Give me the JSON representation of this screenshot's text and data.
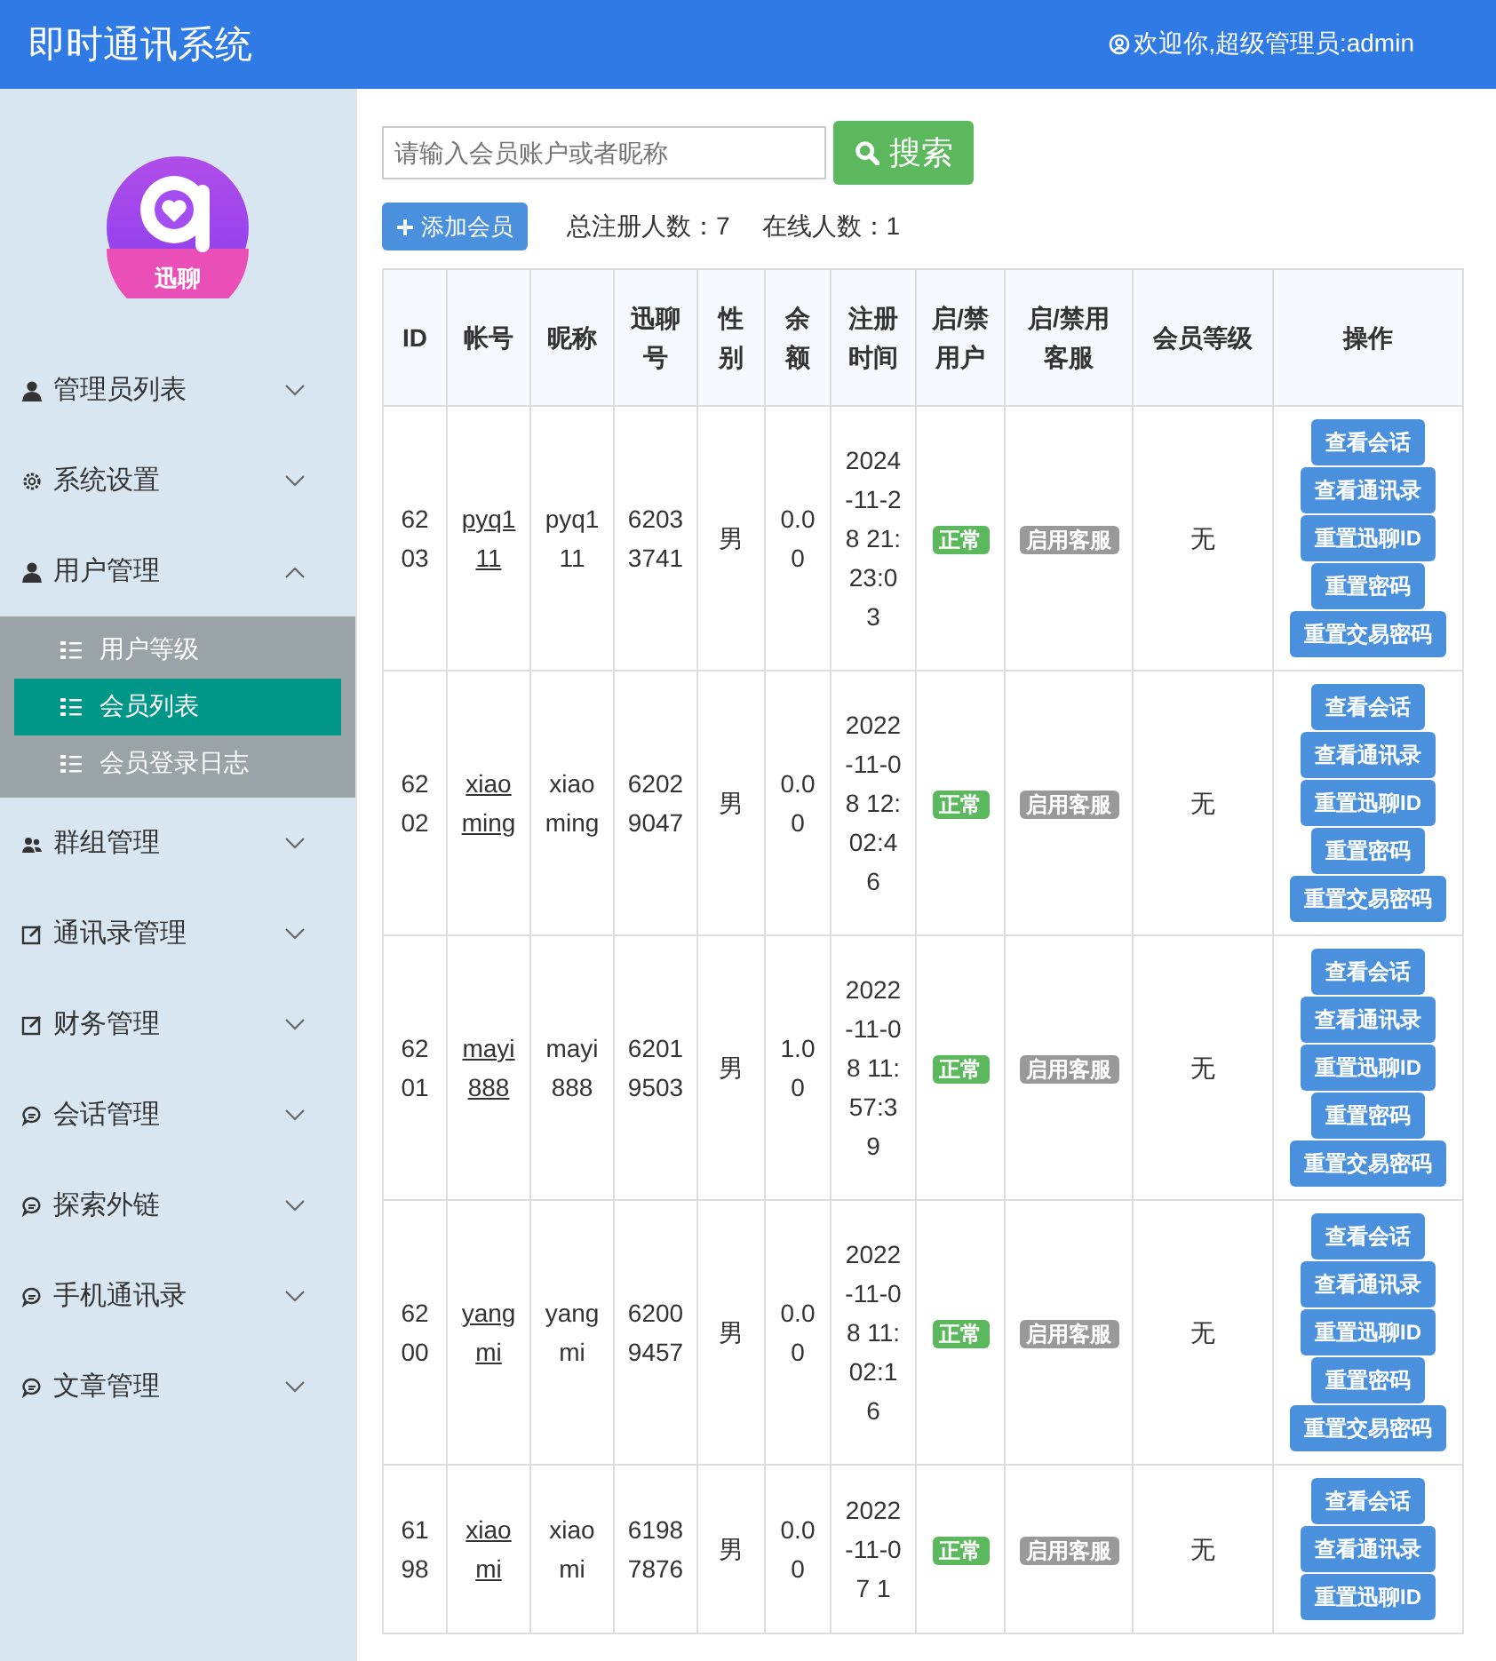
{
  "header": {
    "title": "即时通讯系统",
    "welcome": "欢迎你,超级管理员:admin"
  },
  "sidebar": {
    "logo_text": "迅聊",
    "items": [
      {
        "label": "管理员列表",
        "expanded": false
      },
      {
        "label": "系统设置",
        "expanded": false
      },
      {
        "label": "用户管理",
        "expanded": true,
        "children": [
          {
            "label": "用户等级",
            "selected": false
          },
          {
            "label": "会员列表",
            "selected": true
          },
          {
            "label": "会员登录日志",
            "selected": false
          }
        ]
      },
      {
        "label": "群组管理",
        "expanded": false
      },
      {
        "label": "通讯录管理",
        "expanded": false
      },
      {
        "label": "财务管理",
        "expanded": false
      },
      {
        "label": "会话管理",
        "expanded": false
      },
      {
        "label": "探索外链",
        "expanded": false
      },
      {
        "label": "手机通讯录",
        "expanded": false
      },
      {
        "label": "文章管理",
        "expanded": false
      }
    ]
  },
  "search": {
    "placeholder": "请输入会员账户或者昵称",
    "button": "搜索"
  },
  "add_button": "添加会员",
  "total_registered": "总注册人数：7",
  "online_count": "在线人数：1",
  "table": {
    "columns": [
      "ID",
      "帐号",
      "昵称",
      "迅聊号",
      "性别",
      "余额",
      "注册时间",
      "启/禁用户",
      "启/禁用客服",
      "会员等级",
      "操作"
    ],
    "rows": [
      {
        "id": "6203",
        "account": "pyq111",
        "nickname": "pyq111",
        "chat_no": "62033741",
        "gender": "男",
        "balance": "0.00",
        "registered": "2024-11-28 21:23:03",
        "status": "正常",
        "service": "启用客服",
        "level": "无",
        "actions": [
          "查看会话",
          "查看通讯录",
          "重置迅聊ID",
          "重置密码",
          "重置交易密码"
        ]
      },
      {
        "id": "6202",
        "account": "xiaoming",
        "nickname": "xiaoming",
        "chat_no": "62029047",
        "gender": "男",
        "balance": "0.00",
        "registered": "2022-11-08 12:02:46",
        "status": "正常",
        "service": "启用客服",
        "level": "无",
        "actions": [
          "查看会话",
          "查看通讯录",
          "重置迅聊ID",
          "重置密码",
          "重置交易密码"
        ]
      },
      {
        "id": "6201",
        "account": "mayi888",
        "nickname": "mayi888",
        "chat_no": "62019503",
        "gender": "男",
        "balance": "1.00",
        "registered": "2022-11-08 11:57:39",
        "status": "正常",
        "service": "启用客服",
        "level": "无",
        "actions": [
          "查看会话",
          "查看通讯录",
          "重置迅聊ID",
          "重置密码",
          "重置交易密码"
        ]
      },
      {
        "id": "6200",
        "account": "yangmi",
        "nickname": "yangmi",
        "chat_no": "62009457",
        "gender": "男",
        "balance": "0.00",
        "registered": "2022-11-08 11:02:16",
        "status": "正常",
        "service": "启用客服",
        "level": "无",
        "actions": [
          "查看会话",
          "查看通讯录",
          "重置迅聊ID",
          "重置密码",
          "重置交易密码"
        ]
      },
      {
        "id": "6198",
        "account": "xiaomi",
        "nickname": "xiaomi",
        "chat_no": "61987876",
        "gender": "男",
        "balance": "0.00",
        "registered": "2022-11-07 1",
        "status": "正常",
        "service": "启用客服",
        "level": "无",
        "actions": [
          "查看会话",
          "查看通讯录",
          "重置迅聊ID"
        ]
      }
    ]
  }
}
